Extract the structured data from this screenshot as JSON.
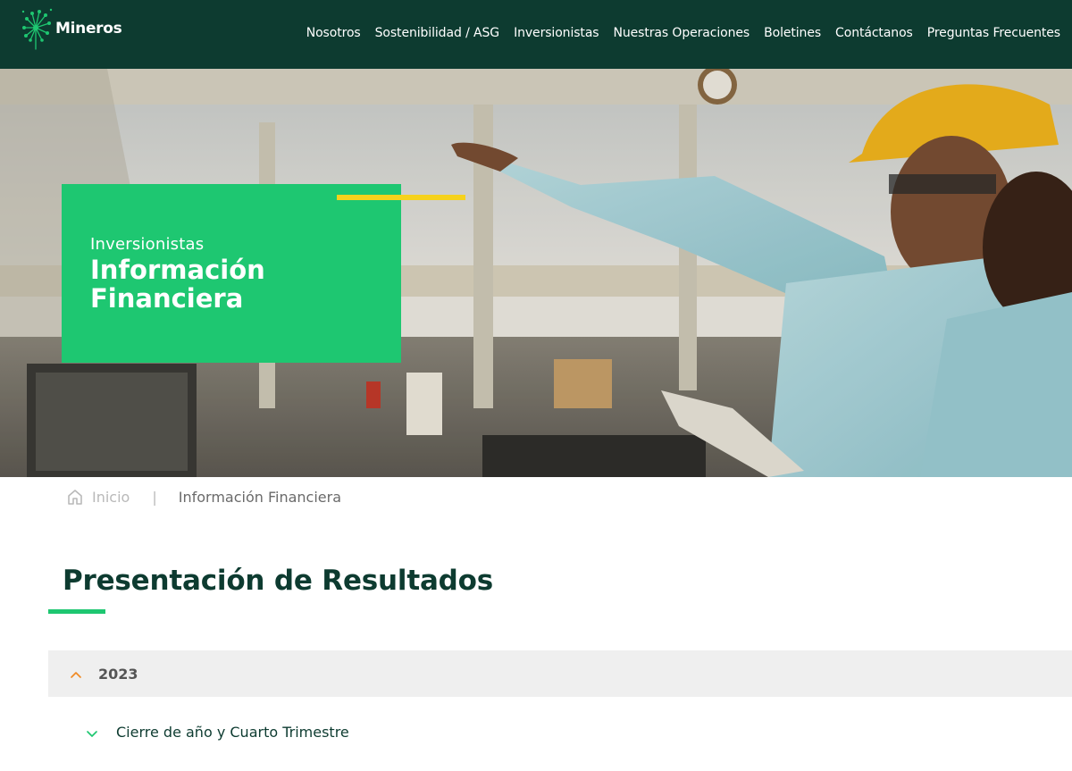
{
  "brand": {
    "name": "Mineros"
  },
  "nav": {
    "items": [
      {
        "label": "Nosotros"
      },
      {
        "label": "Sostenibilidad / ASG"
      },
      {
        "label": "Inversionistas"
      },
      {
        "label": "Nuestras Operaciones"
      },
      {
        "label": "Boletines"
      },
      {
        "label": "Contáctanos"
      },
      {
        "label": "Preguntas Frecuentes"
      }
    ]
  },
  "hero": {
    "kicker": "Inversionistas",
    "title": "Información Financiera"
  },
  "breadcrumb": {
    "home": "Inicio",
    "separator": "|",
    "current": "Información Financiera"
  },
  "section": {
    "title": "Presentación de Resultados"
  },
  "accordion": {
    "year": "2023",
    "year_state": "expanded",
    "items": [
      {
        "label": "Cierre de año y Cuarto Trimestre"
      }
    ]
  },
  "colors": {
    "header_bg": "#0d3b30",
    "brand_green": "#1ec771",
    "accent_yellow": "#f6d21c",
    "accordion_chevron": "#f08a24",
    "sub_chevron": "#1ec771"
  },
  "icons": {
    "logo": "dandelion-logo-icon",
    "home": "home-icon",
    "year_toggle": "chevron-up-icon",
    "item_toggle": "chevron-down-icon"
  }
}
